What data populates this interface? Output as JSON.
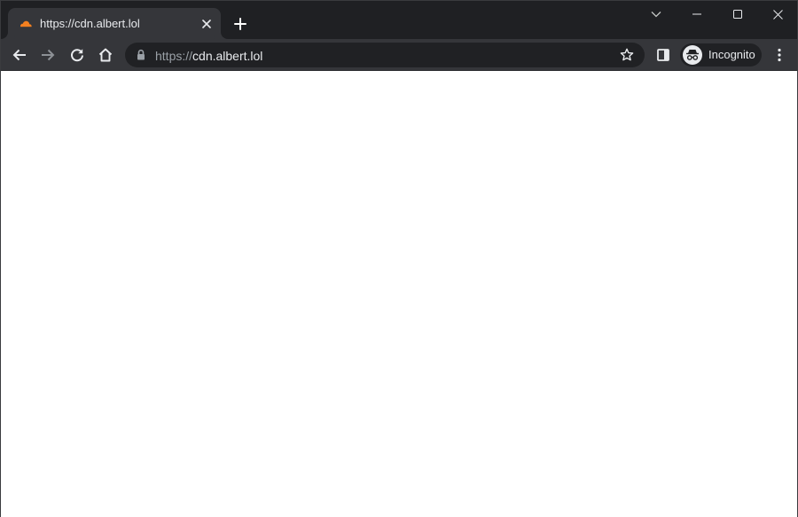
{
  "browser": {
    "mode": "incognito",
    "theme_colors": {
      "frame": "#1f2023",
      "toolbar": "#35363a",
      "omnibox": "#202124",
      "text": "#e8eaed",
      "muted_text": "#9aa0a6",
      "favicon": "#f38020"
    }
  },
  "tab": {
    "title": "https://cdn.albert.lol",
    "favicon": "cloud-icon",
    "close_icon": "close-icon"
  },
  "new_tab_icon": "plus-icon",
  "window_controls": [
    "tab-search-icon",
    "minimize-icon",
    "maximize-icon",
    "close-icon"
  ],
  "toolbar": {
    "nav_icons": [
      "back-arrow-icon",
      "forward-arrow-icon",
      "reload-icon",
      "home-icon"
    ],
    "address": {
      "scheme": "https://",
      "host": "cdn.albert.lol",
      "security_icon": "lock-icon",
      "bookmark_icon": "star-icon"
    },
    "side_panel_icon": "side-panel-icon",
    "incognito_label": "Incognito",
    "menu_icon": "kebab-menu-icon"
  },
  "page": {
    "background": "#ffffff"
  }
}
